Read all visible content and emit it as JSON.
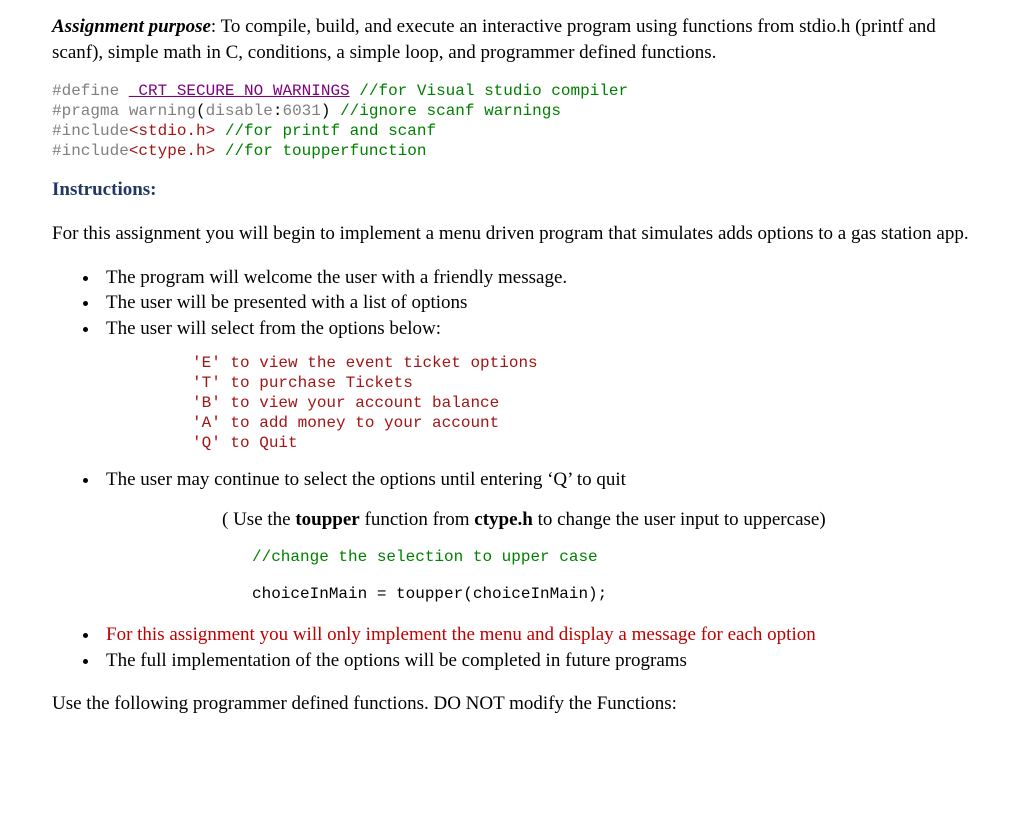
{
  "purpose": {
    "label": "Assignment purpose",
    "text": ": To compile, build, and execute an interactive program using functions from stdio.h (printf and scanf), simple math in C, conditions, a simple loop, and programmer defined functions."
  },
  "code": {
    "l1_define": "#define ",
    "l1_macro": "_CRT_SECURE_NO_WARNINGS",
    "l1_comment": " //for Visual studio compiler",
    "l2_pragma": "#pragma warning",
    "l2_paren_open": "(",
    "l2_disable": "disable",
    "l2_colon": ":",
    "l2_num": "6031",
    "l2_paren_close": ") ",
    "l2_comment": "//ignore scanf warnings",
    "l3_include": "#include",
    "l3_header": "<stdio.h>",
    "l3_comment": " //for printf and scanf",
    "l4_include": "#include",
    "l4_header": "<ctype.h>",
    "l4_comment": " //for toupperfunction"
  },
  "instructions_label": "Instructions:",
  "intro_para": "For this assignment you will begin to implement a menu driven program that simulates adds options to a gas station app.",
  "bullets_top": [
    "The program will welcome the user with a friendly message.",
    "The user will be presented with a list of options",
    "The user will select from the options below:"
  ],
  "menu": "'E' to view the event ticket options\n'T' to purchase Tickets\n'B' to view your account balance\n'A' to add money to your account\n'Q' to Quit",
  "bullet_continue": "The user may continue to select the options until entering ‘Q’ to quit",
  "toupper_note": {
    "pre": "( Use the ",
    "b1": "toupper",
    "mid": " function from ",
    "b2": "ctype.h",
    "post": " to change the user input to uppercase)"
  },
  "change_comment": "//change the selection to upper case",
  "toupper_code": "choiceInMain = toupper(choiceInMain);",
  "bullets_bottom": {
    "red": "For this assignment you will only implement the menu and display a message for each option",
    "black": "The full  implementation of the options will be completed in future programs"
  },
  "footer": "Use the following programmer defined functions. DO NOT modify the Functions:"
}
